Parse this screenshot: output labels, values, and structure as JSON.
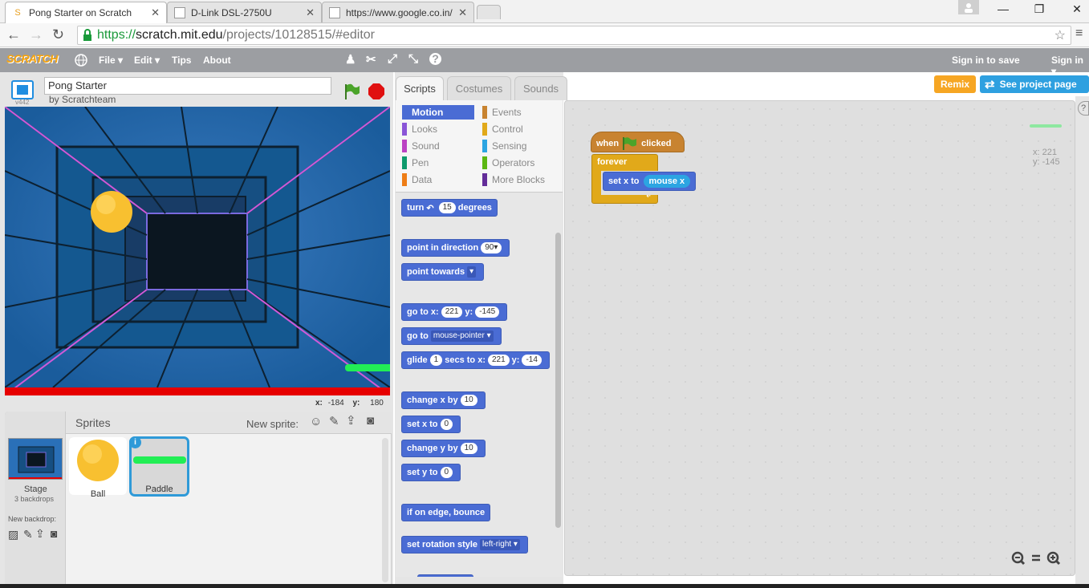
{
  "browser": {
    "tabs": [
      {
        "title": "Pong Starter on Scratch",
        "icon": "scratch-cat-icon"
      },
      {
        "title": "D-Link DSL-2750U",
        "icon": "page-icon"
      },
      {
        "title": "https://www.google.co.in/",
        "icon": "page-icon"
      }
    ],
    "close_glyph": "✕",
    "url_prefix": "https://",
    "url_domain": "scratch.mit.edu",
    "url_path": "/projects/10128515/#editor"
  },
  "menu": {
    "logo": "SCRATCH",
    "items": [
      "File ▾",
      "Edit ▾",
      "Tips",
      "About"
    ],
    "sign_in_save": "Sign in to save",
    "sign_in": "Sign in ▾"
  },
  "project": {
    "title": "Pong Starter",
    "author": "by Scratchteam",
    "version": "v442",
    "remix": "Remix",
    "see_page": "See project page"
  },
  "stage": {
    "x_label": "x:",
    "x_value": "-184",
    "y_label": "y:",
    "y_value": "180"
  },
  "sprites_panel": {
    "header": "Sprites",
    "new_sprite": "New sprite:",
    "stage_label": "Stage",
    "stage_sub": "3 backdrops",
    "new_backdrop": "New backdrop:",
    "sprites": [
      "Ball",
      "Paddle"
    ]
  },
  "editor_tabs": [
    "Scripts",
    "Costumes",
    "Sounds"
  ],
  "categories": [
    {
      "name": "Motion",
      "color": "#4a6cd4"
    },
    {
      "name": "Events",
      "color": "#c88330"
    },
    {
      "name": "Looks",
      "color": "#8a55d7"
    },
    {
      "name": "Control",
      "color": "#e1a91a"
    },
    {
      "name": "Sound",
      "color": "#bb42c3"
    },
    {
      "name": "Sensing",
      "color": "#2ca5e2"
    },
    {
      "name": "Pen",
      "color": "#0e9a6c"
    },
    {
      "name": "Operators",
      "color": "#5cb712"
    },
    {
      "name": "Data",
      "color": "#ee7d16"
    },
    {
      "name": "More Blocks",
      "color": "#632d99"
    }
  ],
  "palette": {
    "turn": "turn",
    "turn_val": "15",
    "degrees": "degrees",
    "point_dir": "point in direction",
    "point_dir_val": "90▾",
    "point_towards": "point towards",
    "goto_xy": "go to x:",
    "goto_x": "221",
    "goto_y_label": "y:",
    "goto_y": "-145",
    "goto": "go to",
    "goto_target": "mouse-pointer ▾",
    "glide": "glide",
    "glide_secs": "1",
    "glide_mid": "secs to x:",
    "glide_x": "221",
    "glide_y_label": "y:",
    "glide_y": "-14",
    "change_x": "change x by",
    "change_x_val": "10",
    "set_x": "set x to",
    "set_x_val": "0",
    "change_y": "change y by",
    "change_y_val": "10",
    "set_y": "set y to",
    "set_y_val": "0",
    "bounce": "if on edge, bounce",
    "rot_style": "set rotation style",
    "rot_style_val": "left-right ▾"
  },
  "script": {
    "when": "when",
    "clicked": "clicked",
    "forever": "forever",
    "set_x": "set x to",
    "mouse_x": "mouse x"
  },
  "sprite_info": {
    "x_label": "x:",
    "x": "221",
    "y_label": "y:",
    "y": "-145"
  }
}
